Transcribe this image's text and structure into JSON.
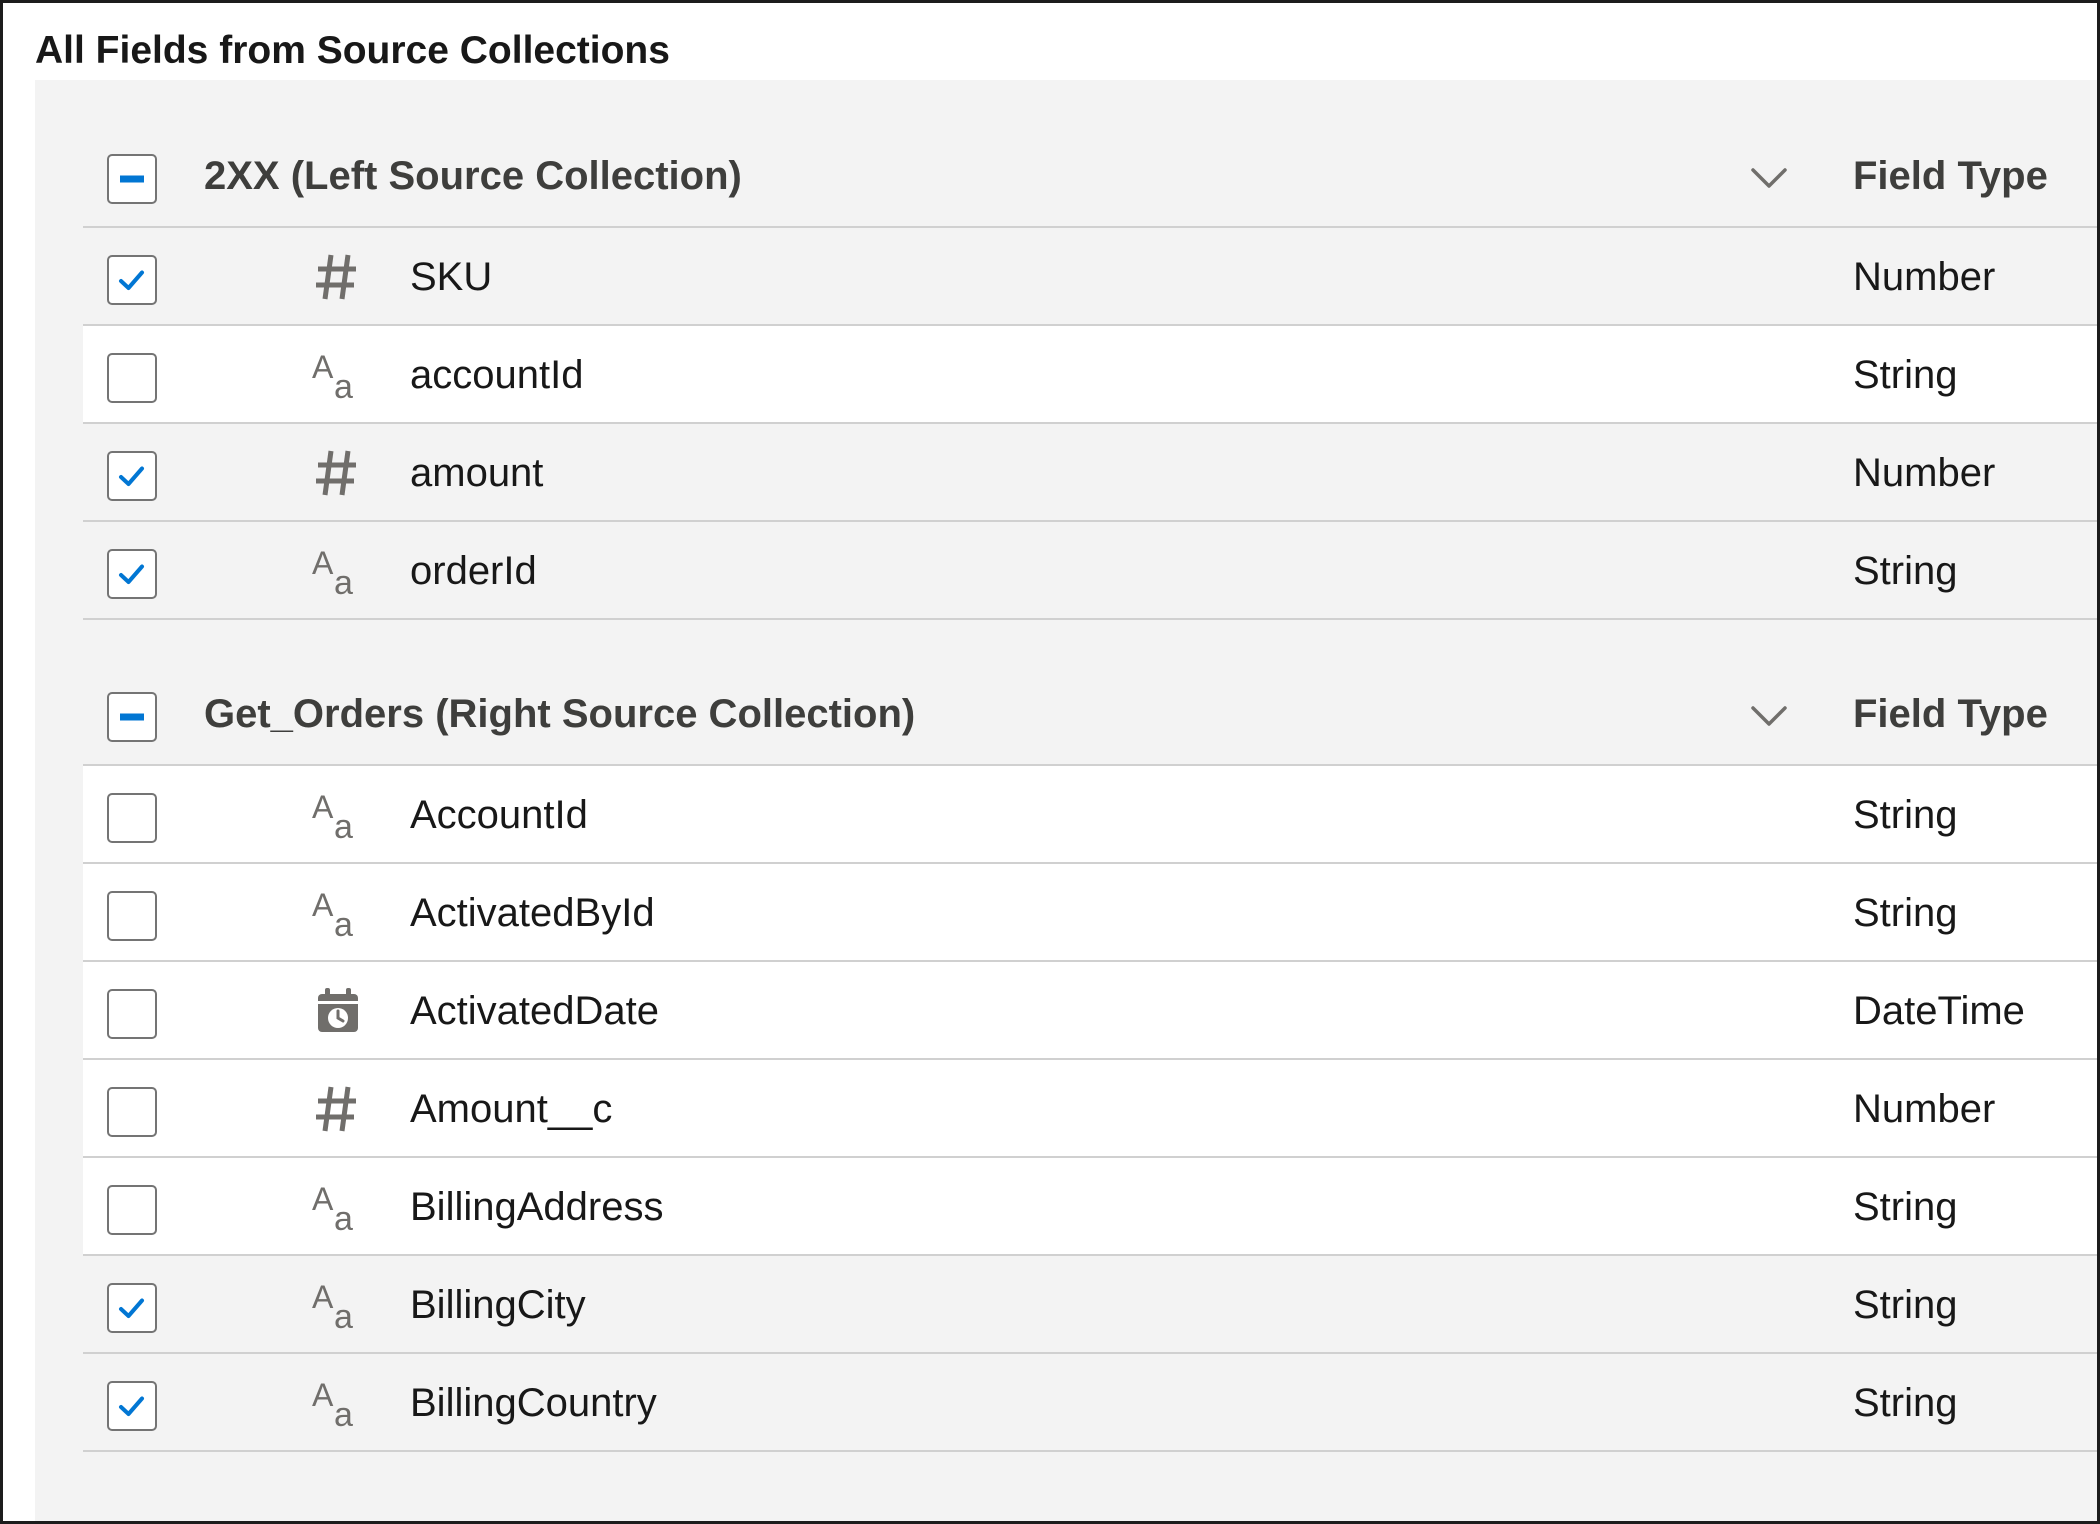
{
  "page_title": "All Fields from Source Collections",
  "icons": {
    "number": "hash-icon",
    "string": "text-icon",
    "datetime": "calendar-clock-icon",
    "chevron": "chevron-down-icon"
  },
  "colors": {
    "accent": "#0176d3",
    "panel_bg": "#f3f3f3",
    "icon_gray": "#706e6b"
  },
  "sections": [
    {
      "title": "2XX (Left Source Collection)",
      "column_header": "Field Type",
      "select_state": "partial",
      "rows": [
        {
          "name": "SKU",
          "type": "Number",
          "icon": "hash-icon",
          "checked": true
        },
        {
          "name": "accountId",
          "type": "String",
          "icon": "text-icon",
          "checked": false
        },
        {
          "name": "amount",
          "type": "Number",
          "icon": "hash-icon",
          "checked": true
        },
        {
          "name": "orderId",
          "type": "String",
          "icon": "text-icon",
          "checked": true
        }
      ]
    },
    {
      "title": "Get_Orders (Right Source Collection)",
      "column_header": "Field Type",
      "select_state": "partial",
      "rows": [
        {
          "name": "AccountId",
          "type": "String",
          "icon": "text-icon",
          "checked": false
        },
        {
          "name": "ActivatedById",
          "type": "String",
          "icon": "text-icon",
          "checked": false
        },
        {
          "name": "ActivatedDate",
          "type": "DateTime",
          "icon": "calendar-clock-icon",
          "checked": false
        },
        {
          "name": "Amount__c",
          "type": "Number",
          "icon": "hash-icon",
          "checked": false
        },
        {
          "name": "BillingAddress",
          "type": "String",
          "icon": "text-icon",
          "checked": false
        },
        {
          "name": "BillingCity",
          "type": "String",
          "icon": "text-icon",
          "checked": true
        },
        {
          "name": "BillingCountry",
          "type": "String",
          "icon": "text-icon",
          "checked": true
        }
      ]
    }
  ]
}
